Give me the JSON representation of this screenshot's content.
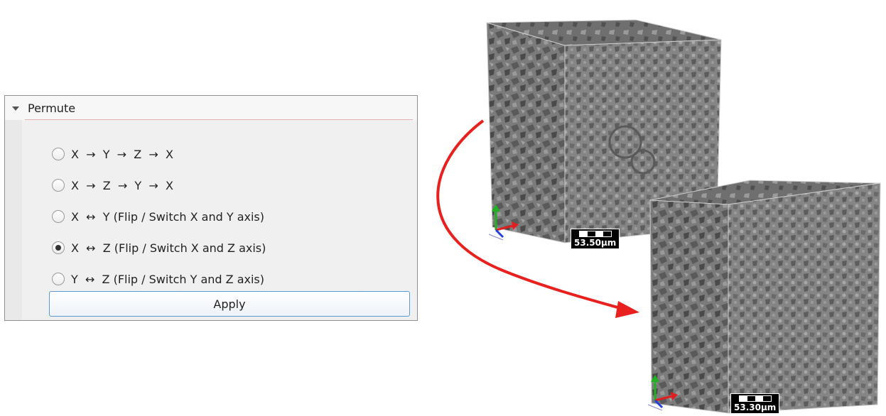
{
  "permute_panel": {
    "title": "Permute",
    "options": [
      {
        "label": "X  →  Y  →  Z  →  X",
        "checked": false
      },
      {
        "label": "X  →  Z  →  Y  →  X",
        "checked": false
      },
      {
        "label": "X  ↔  Y (Flip / Switch X and Y axis)",
        "checked": false
      },
      {
        "label": "X  ↔  Z (Flip / Switch X and Z axis)",
        "checked": true
      },
      {
        "label": "Y  ↔  Z (Flip / Switch Y and Z axis)",
        "checked": false
      }
    ],
    "apply_label": "Apply"
  },
  "volumes": {
    "top_scale": "53.50µm",
    "bottom_scale": "53.30µm"
  },
  "colors": {
    "arrow": "#e8201e",
    "apply_border": "#5b9bd5",
    "axis_x": "#e02020",
    "axis_y": "#20b020",
    "axis_z": "#2040e0"
  },
  "icons": [
    "collapse-arrow-icon",
    "radio-icon",
    "axis-triad-icon",
    "curved-arrow-icon",
    "scale-bar-icon"
  ]
}
